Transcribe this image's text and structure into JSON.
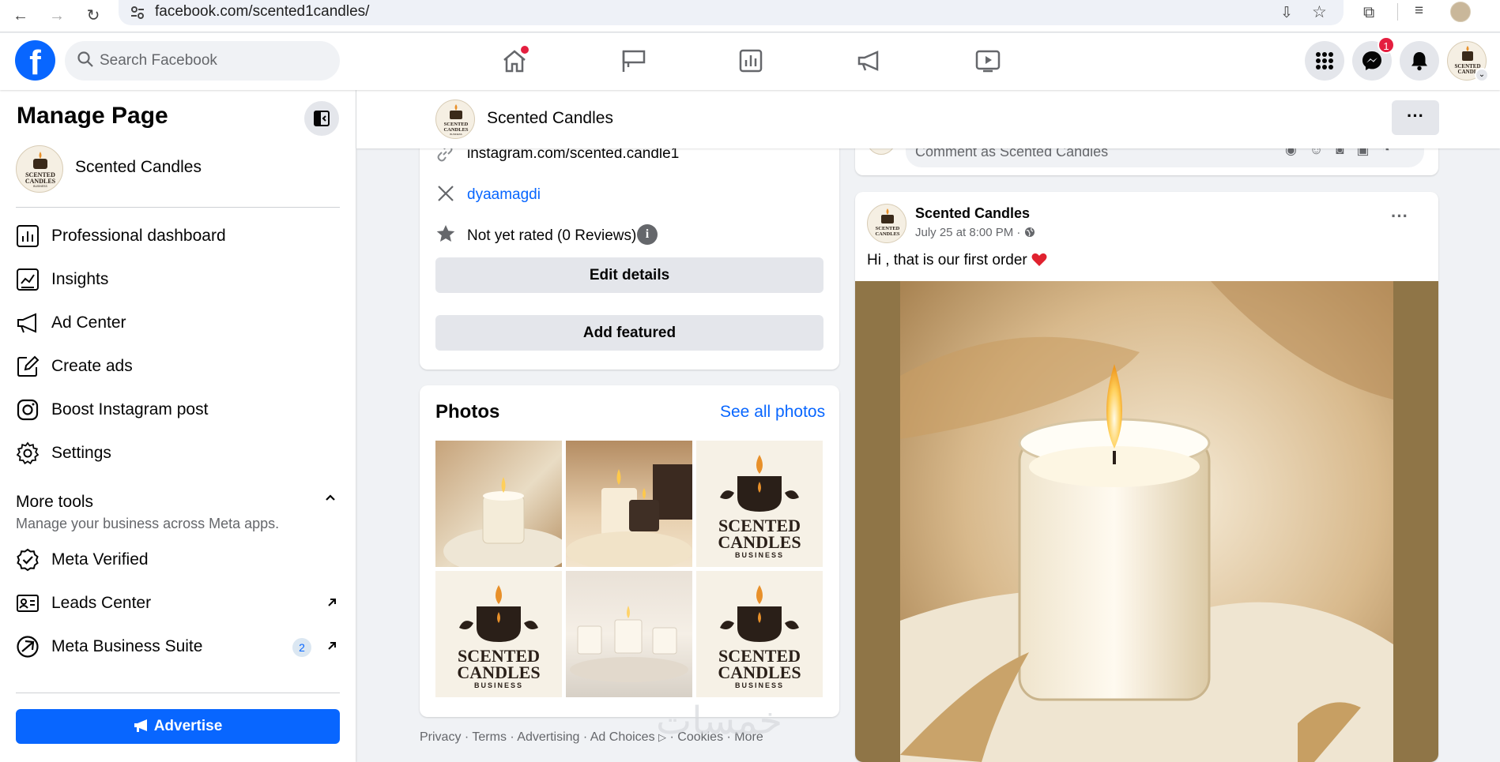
{
  "browser": {
    "url": "facebook.com/scented1candles/"
  },
  "header": {
    "search_placeholder": "Search Facebook",
    "messenger_badge": "1",
    "nav_icons": [
      "home-icon",
      "flag-icon",
      "dashboard-icon",
      "megaphone-icon",
      "video-icon"
    ]
  },
  "sidebar": {
    "title": "Manage Page",
    "page_name": "Scented Candles",
    "items": [
      {
        "label": "Professional dashboard"
      },
      {
        "label": "Insights"
      },
      {
        "label": "Ad Center"
      },
      {
        "label": "Create ads"
      },
      {
        "label": "Boost Instagram post"
      },
      {
        "label": "Settings"
      }
    ],
    "more_tools": {
      "title": "More tools",
      "subtitle": "Manage your business across Meta apps.",
      "items": [
        {
          "label": "Meta Verified"
        },
        {
          "label": "Leads Center"
        },
        {
          "label": "Meta Business Suite",
          "badge": "2"
        }
      ]
    },
    "advertise_label": "Advertise"
  },
  "pagebar": {
    "name": "Scented Candles",
    "more": "···"
  },
  "intro": {
    "instagram": "instagram.com/scented.candle1",
    "x_handle": "dyaamagdi",
    "rating": "Not yet rated (0 Reviews)",
    "edit_details": "Edit details",
    "add_featured": "Add featured"
  },
  "photos": {
    "title": "Photos",
    "see_all": "See all photos",
    "logo_line1": "SCENTED",
    "logo_line2": "CANDLES",
    "logo_line3": "BUSINESS"
  },
  "comment": {
    "placeholder": "Comment as Scented Candles"
  },
  "post": {
    "author": "Scented Candles",
    "time": "July 25 at 8:00 PM",
    "separator": "·",
    "text": "Hi , that is our first order",
    "more": "···"
  },
  "footer": {
    "links": "Privacy · Terms · Advertising · Ad Choices",
    "links2": "· Cookies · More"
  },
  "colors": {
    "brand": "#0866ff",
    "badge": "#e41e3f",
    "candle_bg": "#8f7547"
  }
}
